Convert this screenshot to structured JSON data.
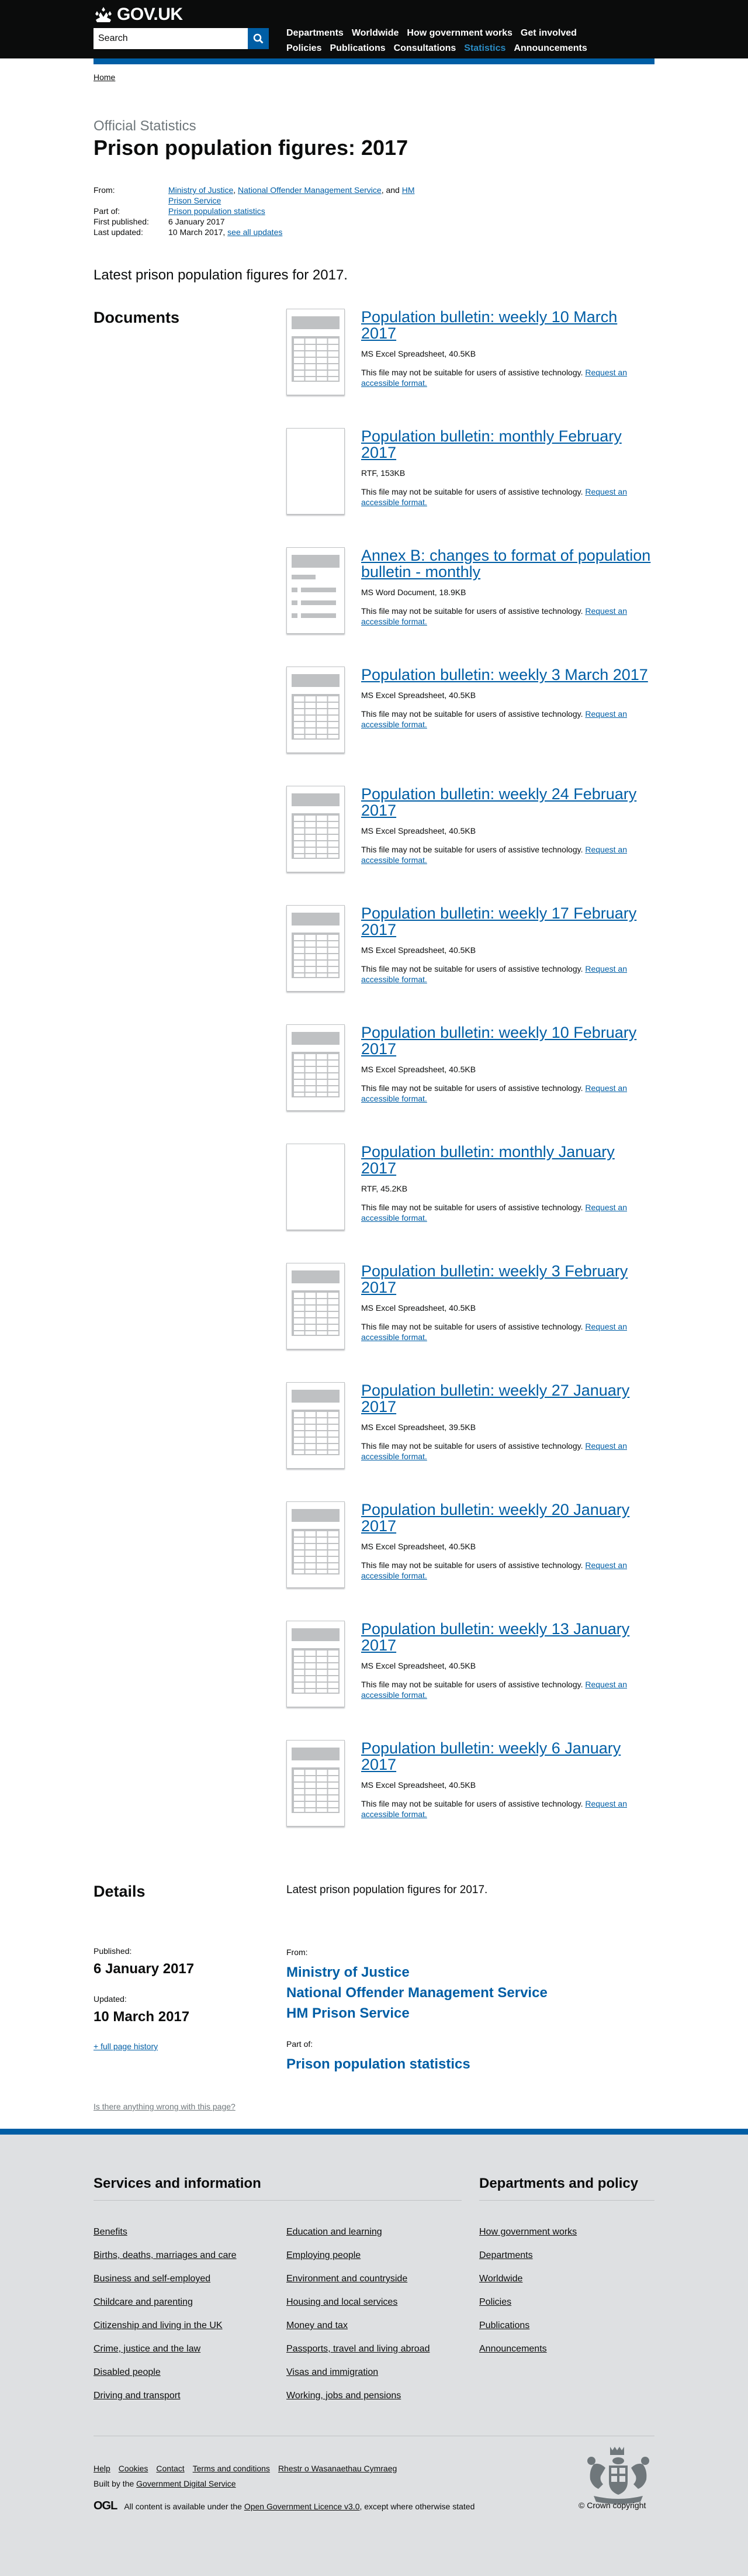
{
  "header": {
    "logo_text": "GOV.UK",
    "search_placeholder": "Search",
    "nav": [
      {
        "label": "Departments",
        "active": false
      },
      {
        "label": "Worldwide",
        "active": false
      },
      {
        "label": "How government works",
        "active": false
      },
      {
        "label": "Get involved",
        "active": false
      },
      {
        "label": "Policies",
        "active": false
      },
      {
        "label": "Publications",
        "active": false
      },
      {
        "label": "Consultations",
        "active": false
      },
      {
        "label": "Statistics",
        "active": true
      },
      {
        "label": "Announcements",
        "active": false
      }
    ]
  },
  "breadcrumb": "Home",
  "doc_type": "Official Statistics",
  "title": "Prison population figures: 2017",
  "meta": {
    "from_label": "From:",
    "from_1": "Ministry of Justice",
    "from_sep_1": ", ",
    "from_2": "National Offender Management Service",
    "from_sep_2": ", and ",
    "from_3": "HM Prison Service",
    "part_of_label": "Part of:",
    "part_of": "Prison population statistics",
    "first_published_label": "First published:",
    "first_published": "6 January 2017",
    "last_updated_label": "Last updated:",
    "last_updated": "10 March 2017, ",
    "see_all_updates": "see all updates"
  },
  "summary": "Latest prison population figures for 2017.",
  "documents_heading": "Documents",
  "documents": [
    {
      "title": "Population bulletin: weekly 10 March 2017",
      "meta": "MS Excel Spreadsheet, 40.5KB",
      "thumb": "spreadsheet"
    },
    {
      "title": "Population bulletin: monthly February 2017",
      "meta": "RTF, 153KB",
      "thumb": "blank"
    },
    {
      "title": "Annex B: changes to format of population bulletin - monthly",
      "meta": "MS Word Document, 18.9KB",
      "thumb": "document"
    },
    {
      "title": "Population bulletin: weekly 3 March 2017",
      "meta": "MS Excel Spreadsheet, 40.5KB",
      "thumb": "spreadsheet"
    },
    {
      "title": "Population bulletin: weekly 24 February 2017",
      "meta": "MS Excel Spreadsheet, 40.5KB",
      "thumb": "spreadsheet"
    },
    {
      "title": "Population bulletin: weekly 17 February 2017",
      "meta": "MS Excel Spreadsheet, 40.5KB",
      "thumb": "spreadsheet"
    },
    {
      "title": "Population bulletin: weekly 10 February 2017",
      "meta": "MS Excel Spreadsheet, 40.5KB",
      "thumb": "spreadsheet"
    },
    {
      "title": "Population bulletin: monthly January 2017",
      "meta": "RTF, 45.2KB",
      "thumb": "blank"
    },
    {
      "title": "Population bulletin: weekly 3 February 2017",
      "meta": "MS Excel Spreadsheet, 40.5KB",
      "thumb": "spreadsheet"
    },
    {
      "title": "Population bulletin: weekly 27 January 2017",
      "meta": "MS Excel Spreadsheet, 39.5KB",
      "thumb": "spreadsheet"
    },
    {
      "title": "Population bulletin: weekly 20 January 2017",
      "meta": "MS Excel Spreadsheet, 40.5KB",
      "thumb": "spreadsheet"
    },
    {
      "title": "Population bulletin: weekly 13 January 2017",
      "meta": "MS Excel Spreadsheet, 40.5KB",
      "thumb": "spreadsheet"
    },
    {
      "title": "Population bulletin: weekly 6 January 2017",
      "meta": "MS Excel Spreadsheet, 40.5KB",
      "thumb": "spreadsheet"
    }
  ],
  "accessibility_note": "This file may not be suitable for users of assistive technology. ",
  "accessibility_link": "Request an accessible format.",
  "details": {
    "heading": "Details",
    "summary": "Latest prison population figures for 2017.",
    "published_label": "Published:",
    "published": "6 January 2017",
    "updated_label": "Updated:",
    "updated": "10 March 2017",
    "history_link": "+ full page history",
    "from_label": "From:",
    "from": [
      "Ministry of Justice",
      "National Offender Management Service",
      "HM Prison Service"
    ],
    "part_of_label": "Part of:",
    "part_of": "Prison population statistics"
  },
  "wrong_link": "Is there anything wrong with this page?",
  "footer": {
    "services_heading": "Services and information",
    "services_links": [
      "Benefits",
      "Education and learning",
      "Births, deaths, marriages and care",
      "Employing people",
      "Business and self-employed",
      "Environment and countryside",
      "Childcare and parenting",
      "Housing and local services",
      "Citizenship and living in the UK",
      "Money and tax",
      "Crime, justice and the law",
      "Passports, travel and living abroad",
      "Disabled people",
      "Visas and immigration",
      "Driving and transport",
      "Working, jobs and pensions"
    ],
    "departments_heading": "Departments and policy",
    "departments_links": [
      "How government works",
      "Departments",
      "Worldwide",
      "Policies",
      "Publications",
      "Announcements"
    ],
    "meta_links": [
      "Help",
      "Cookies",
      "Contact",
      "Terms and conditions",
      "Rhestr o Wasanaethau Cymraeg"
    ],
    "built_by_prefix": "Built by the ",
    "built_by_link": "Government Digital Service",
    "ogl_mark": "OGL",
    "licence_prefix": "All content is available under the ",
    "licence_link": "Open Government Licence v3.0",
    "licence_suffix": ", except where otherwise stated",
    "copyright": "© Crown copyright"
  },
  "colors": {
    "header_bg": "#0b0c0c",
    "brand_blue": "#005ea5",
    "link_blue": "#005ea5",
    "active_nav": "#2b8cc4",
    "footer_bg": "#dee0e2",
    "secondary_text": "#6f777b"
  }
}
